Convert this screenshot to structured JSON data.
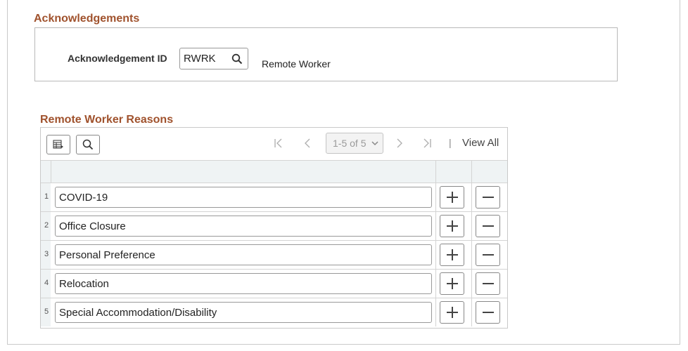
{
  "acknowledgements": {
    "title": "Acknowledgements",
    "id_label": "Acknowledgement ID",
    "id_value": "RWRK",
    "description": "Remote Worker"
  },
  "reasons_grid": {
    "title": "Remote Worker Reasons",
    "pager": "1-5 of 5",
    "separator": "|",
    "view_all": "View All",
    "rows": [
      {
        "num": "1",
        "reason": "COVID-19"
      },
      {
        "num": "2",
        "reason": "Office Closure"
      },
      {
        "num": "3",
        "reason": "Personal Preference"
      },
      {
        "num": "4",
        "reason": "Relocation"
      },
      {
        "num": "5",
        "reason": "Special Accommodation/Disability"
      }
    ]
  },
  "icons": {
    "lookup": "search-icon",
    "personalize": "grid-personalize-icon",
    "find": "search-icon",
    "first": "first-page-icon",
    "prev": "previous-page-icon",
    "next": "next-page-icon",
    "last": "last-page-icon",
    "add": "plus-icon",
    "delete": "minus-icon"
  },
  "colors": {
    "section_title": "#a0522d",
    "header_bg": "#eff3f4",
    "border": "#c9c9c9"
  }
}
